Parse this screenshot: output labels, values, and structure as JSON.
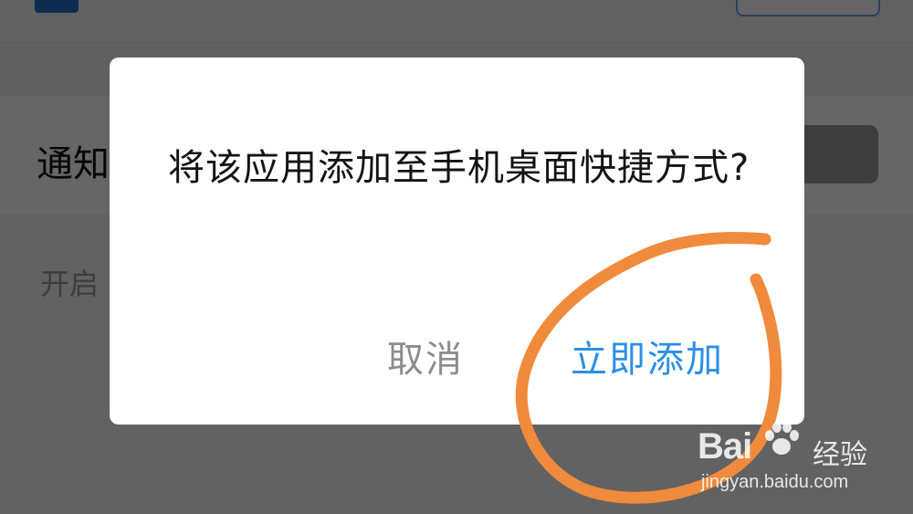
{
  "background_app": {
    "title_partial": "",
    "notify_label": "通知",
    "open_label": "开启"
  },
  "dialog": {
    "message": "将该应用添加至手机桌面快捷方式?",
    "cancel_label": "取消",
    "confirm_label": "立即添加"
  },
  "annotation": {
    "color": "#f08a3c",
    "shape": "circle-around-confirm-button"
  },
  "watermark": {
    "brand": "Bai",
    "brand_suffix": "经验",
    "url": "jingyan.baidu.com"
  },
  "colors": {
    "accent": "#2b8fe6",
    "cancel_text": "#8c8c8c",
    "overlay": "rgba(0,0,0,0.6)"
  }
}
